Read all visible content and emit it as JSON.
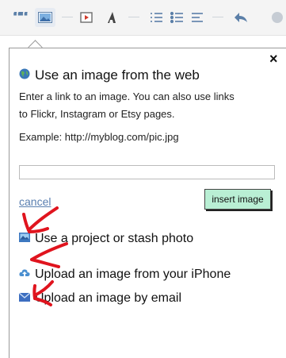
{
  "toolbar": {
    "icons": [
      "quote-icon",
      "image-icon",
      "video-icon",
      "dropcap-icon",
      "ordered-list-icon",
      "bullet-list-icon",
      "align-left-icon",
      "undo-icon",
      "more-icon"
    ]
  },
  "popup": {
    "close_label": "×",
    "web_title": "Use an image from the web",
    "desc_line1": "Enter a link to an image. You can also use links",
    "desc_line2": "to Flickr, Instagram or Etsy pages.",
    "example": "Example: http://myblog.com/pic.jpg",
    "url_value": "",
    "url_placeholder": "",
    "cancel_label": "cancel",
    "insert_label": "insert image",
    "options": {
      "project_label": "Use a project or stash photo",
      "iphone_label": "Upload an image from your iPhone",
      "email_label": "Upload an image by email"
    }
  },
  "colors": {
    "accent": "#5a7fb0",
    "insert_bg": "#b9efd4",
    "annotation": "#e0141e"
  }
}
